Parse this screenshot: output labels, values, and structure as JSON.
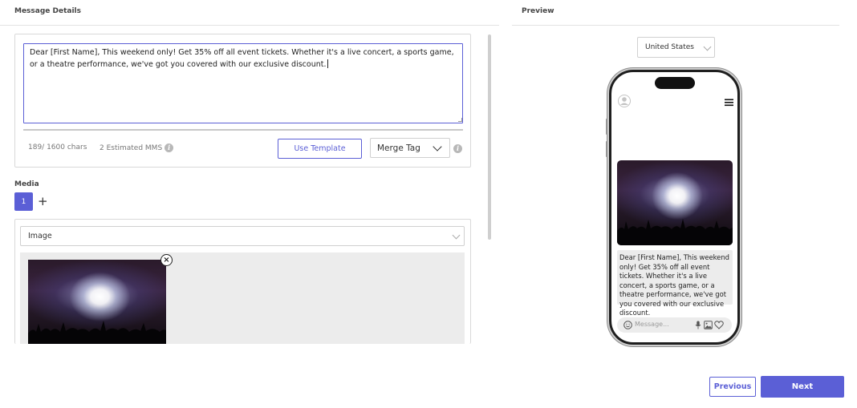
{
  "message_details": {
    "title": "Message Details",
    "message_text": "Dear [First Name], This weekend only! Get 35% off all event tickets. Whether it's a live concert, a sports game, or a theatre performance, we've got you covered with our exclusive discount.",
    "char_count": "189/ 1600 chars",
    "estimated_mms": "2 Estimated MMS",
    "use_template_label": "Use Template",
    "merge_tag_label": "Merge Tag"
  },
  "media": {
    "title": "Media",
    "tabs": [
      "1"
    ],
    "add_label": "+",
    "type_selected": "Image",
    "remove_icon": "close-icon"
  },
  "preview": {
    "title": "Preview",
    "country_selected": "United States",
    "message_text": "Dear [First Name], This weekend only! Get 35% off all event tickets. Whether it's a live concert, a sports game, or a theatre performance, we've got you covered with our exclusive discount.",
    "composer_placeholder": "Message..."
  },
  "footer": {
    "previous_label": "Previous",
    "next_label": "Next"
  },
  "colors": {
    "accent": "#5b5fd6",
    "border": "#d9d9d9",
    "bubble": "#ececec"
  }
}
